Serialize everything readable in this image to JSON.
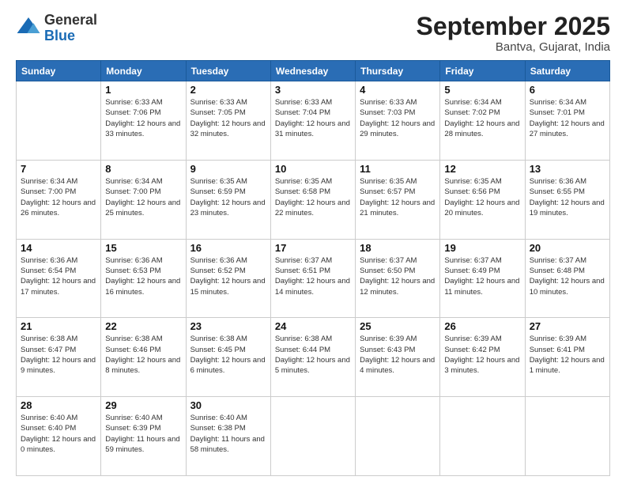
{
  "logo": {
    "general": "General",
    "blue": "Blue"
  },
  "header": {
    "month": "September 2025",
    "location": "Bantva, Gujarat, India"
  },
  "weekdays": [
    "Sunday",
    "Monday",
    "Tuesday",
    "Wednesday",
    "Thursday",
    "Friday",
    "Saturday"
  ],
  "weeks": [
    [
      null,
      {
        "day": 1,
        "sunrise": "6:33 AM",
        "sunset": "7:06 PM",
        "daylight": "12 hours and 33 minutes."
      },
      {
        "day": 2,
        "sunrise": "6:33 AM",
        "sunset": "7:05 PM",
        "daylight": "12 hours and 32 minutes."
      },
      {
        "day": 3,
        "sunrise": "6:33 AM",
        "sunset": "7:04 PM",
        "daylight": "12 hours and 31 minutes."
      },
      {
        "day": 4,
        "sunrise": "6:33 AM",
        "sunset": "7:03 PM",
        "daylight": "12 hours and 29 minutes."
      },
      {
        "day": 5,
        "sunrise": "6:34 AM",
        "sunset": "7:02 PM",
        "daylight": "12 hours and 28 minutes."
      },
      {
        "day": 6,
        "sunrise": "6:34 AM",
        "sunset": "7:01 PM",
        "daylight": "12 hours and 27 minutes."
      }
    ],
    [
      {
        "day": 7,
        "sunrise": "6:34 AM",
        "sunset": "7:00 PM",
        "daylight": "12 hours and 26 minutes."
      },
      {
        "day": 8,
        "sunrise": "6:34 AM",
        "sunset": "7:00 PM",
        "daylight": "12 hours and 25 minutes."
      },
      {
        "day": 9,
        "sunrise": "6:35 AM",
        "sunset": "6:59 PM",
        "daylight": "12 hours and 23 minutes."
      },
      {
        "day": 10,
        "sunrise": "6:35 AM",
        "sunset": "6:58 PM",
        "daylight": "12 hours and 22 minutes."
      },
      {
        "day": 11,
        "sunrise": "6:35 AM",
        "sunset": "6:57 PM",
        "daylight": "12 hours and 21 minutes."
      },
      {
        "day": 12,
        "sunrise": "6:35 AM",
        "sunset": "6:56 PM",
        "daylight": "12 hours and 20 minutes."
      },
      {
        "day": 13,
        "sunrise": "6:36 AM",
        "sunset": "6:55 PM",
        "daylight": "12 hours and 19 minutes."
      }
    ],
    [
      {
        "day": 14,
        "sunrise": "6:36 AM",
        "sunset": "6:54 PM",
        "daylight": "12 hours and 17 minutes."
      },
      {
        "day": 15,
        "sunrise": "6:36 AM",
        "sunset": "6:53 PM",
        "daylight": "12 hours and 16 minutes."
      },
      {
        "day": 16,
        "sunrise": "6:36 AM",
        "sunset": "6:52 PM",
        "daylight": "12 hours and 15 minutes."
      },
      {
        "day": 17,
        "sunrise": "6:37 AM",
        "sunset": "6:51 PM",
        "daylight": "12 hours and 14 minutes."
      },
      {
        "day": 18,
        "sunrise": "6:37 AM",
        "sunset": "6:50 PM",
        "daylight": "12 hours and 12 minutes."
      },
      {
        "day": 19,
        "sunrise": "6:37 AM",
        "sunset": "6:49 PM",
        "daylight": "12 hours and 11 minutes."
      },
      {
        "day": 20,
        "sunrise": "6:37 AM",
        "sunset": "6:48 PM",
        "daylight": "12 hours and 10 minutes."
      }
    ],
    [
      {
        "day": 21,
        "sunrise": "6:38 AM",
        "sunset": "6:47 PM",
        "daylight": "12 hours and 9 minutes."
      },
      {
        "day": 22,
        "sunrise": "6:38 AM",
        "sunset": "6:46 PM",
        "daylight": "12 hours and 8 minutes."
      },
      {
        "day": 23,
        "sunrise": "6:38 AM",
        "sunset": "6:45 PM",
        "daylight": "12 hours and 6 minutes."
      },
      {
        "day": 24,
        "sunrise": "6:38 AM",
        "sunset": "6:44 PM",
        "daylight": "12 hours and 5 minutes."
      },
      {
        "day": 25,
        "sunrise": "6:39 AM",
        "sunset": "6:43 PM",
        "daylight": "12 hours and 4 minutes."
      },
      {
        "day": 26,
        "sunrise": "6:39 AM",
        "sunset": "6:42 PM",
        "daylight": "12 hours and 3 minutes."
      },
      {
        "day": 27,
        "sunrise": "6:39 AM",
        "sunset": "6:41 PM",
        "daylight": "12 hours and 1 minute."
      }
    ],
    [
      {
        "day": 28,
        "sunrise": "6:40 AM",
        "sunset": "6:40 PM",
        "daylight": "12 hours and 0 minutes."
      },
      {
        "day": 29,
        "sunrise": "6:40 AM",
        "sunset": "6:39 PM",
        "daylight": "11 hours and 59 minutes."
      },
      {
        "day": 30,
        "sunrise": "6:40 AM",
        "sunset": "6:38 PM",
        "daylight": "11 hours and 58 minutes."
      },
      null,
      null,
      null,
      null
    ]
  ]
}
